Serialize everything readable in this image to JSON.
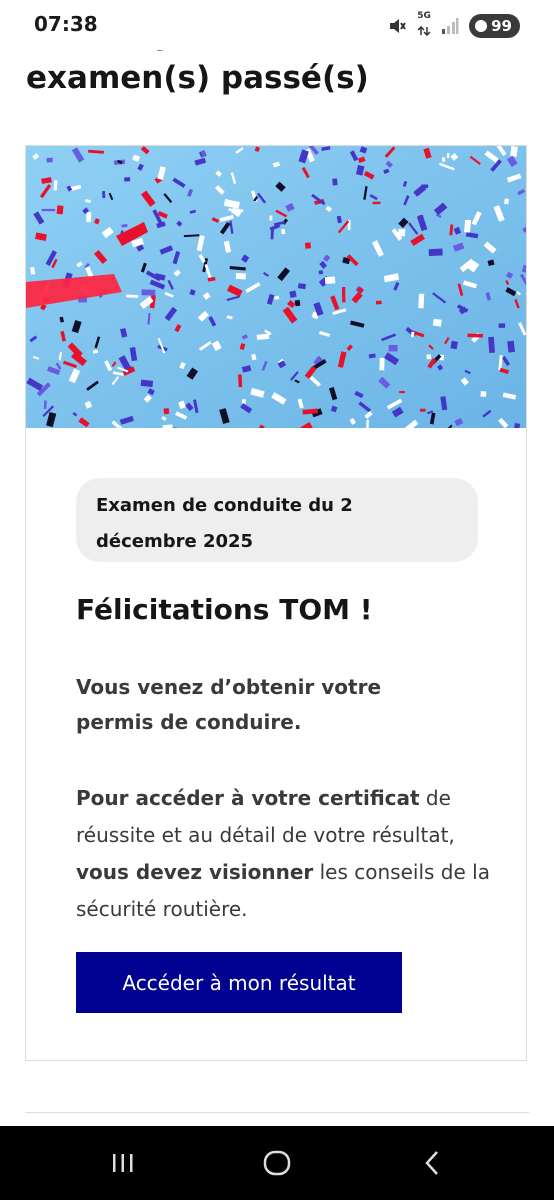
{
  "status_bar": {
    "time": "07:38",
    "network": "5G",
    "battery": "99",
    "icons": [
      "mute-icon",
      "network-arrows-icon",
      "signal-icon",
      "battery-leaf-icon"
    ]
  },
  "page": {
    "heading": "Historique du/des examen(s) passé(s)"
  },
  "card": {
    "image": "confetti-image",
    "date_tag": "Examen de conduite du 2 décembre 2025",
    "title": "Félicitations TOM !",
    "obtained": "Vous venez d’obtenir votre permis de conduire.",
    "instructions": {
      "part1_bold": "Pour accéder à votre certificat",
      "part2": " de réussite et au détail de votre résultat, ",
      "part3_bold": "vous devez visionner",
      "part4": " les conseils de la sécurité routière."
    },
    "button_label": "Accéder à mon résultat"
  },
  "nav_bar": {
    "icons": [
      "recent-apps-icon",
      "home-icon",
      "back-icon"
    ]
  },
  "colors": {
    "primary_button": "#000091",
    "confetti_sky": "#7ec4ec",
    "confetti_red": "#e8102a",
    "confetti_blue": "#4636c8",
    "tag_background": "#eeeeee"
  }
}
